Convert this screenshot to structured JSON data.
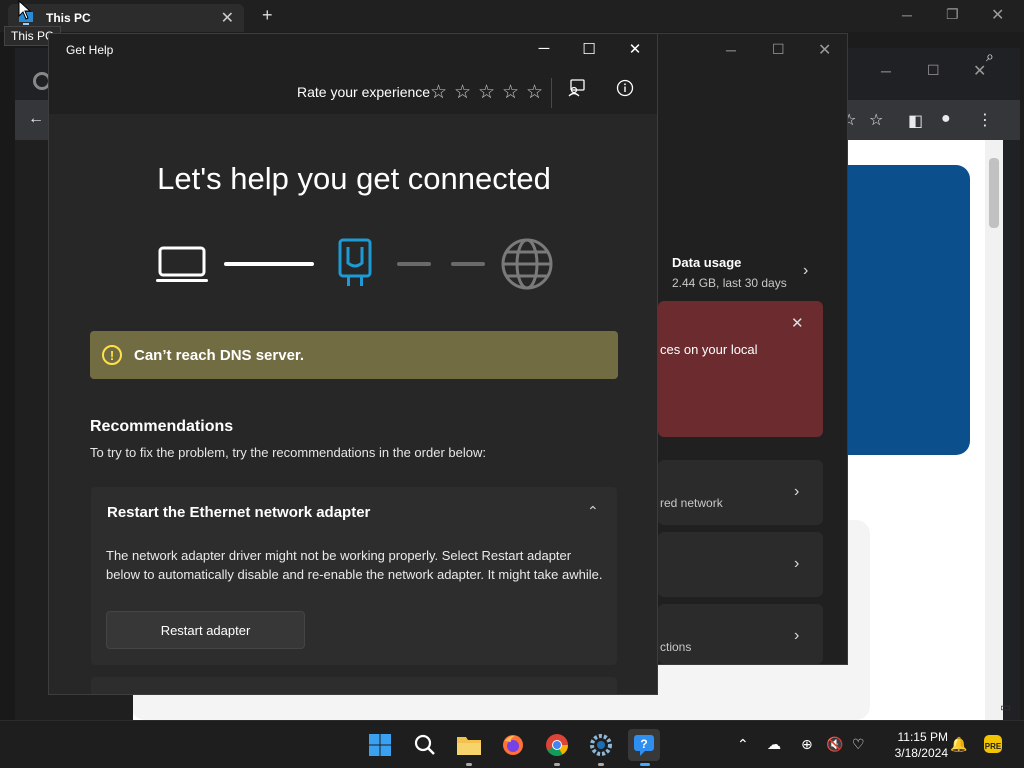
{
  "explorer": {
    "tab_title": "This PC",
    "tooltip": "This PC"
  },
  "settings_bg": {
    "data_usage_label": "Data usage",
    "data_usage_value": "2.44 GB, last 30 days",
    "alert_text_fragment": "ces on your local",
    "row1_text": "red network",
    "row3_text": "ctions"
  },
  "get_help": {
    "title": "Get Help",
    "rate_label": "Rate your experience",
    "stars": 5,
    "headline": "Let's help you get connected",
    "banner_text": "Can’t reach DNS server.",
    "recommendations_title": "Recommendations",
    "recommendations_sub": "To try to fix the problem, try the recommendations in the order below:",
    "card": {
      "title": "Restart the Ethernet network adapter",
      "body": "The network adapter driver might not be working properly. Select Restart adapter below to automatically disable and re-enable the network adapter. It might take awhile.",
      "button_label": "Restart adapter"
    }
  },
  "taskbar": {
    "apps": [
      "start-icon",
      "search-icon",
      "file-explorer-icon",
      "firefox-icon",
      "chrome-icon",
      "settings-icon",
      "get-help-icon"
    ],
    "time": "11:15 PM",
    "date": "3/18/2024"
  },
  "colors": {
    "accent_blue": "#1d9bd6",
    "banner_bg": "#726c43",
    "warning_yellow": "#ffe14a",
    "alert_red": "#6b2b2f"
  }
}
